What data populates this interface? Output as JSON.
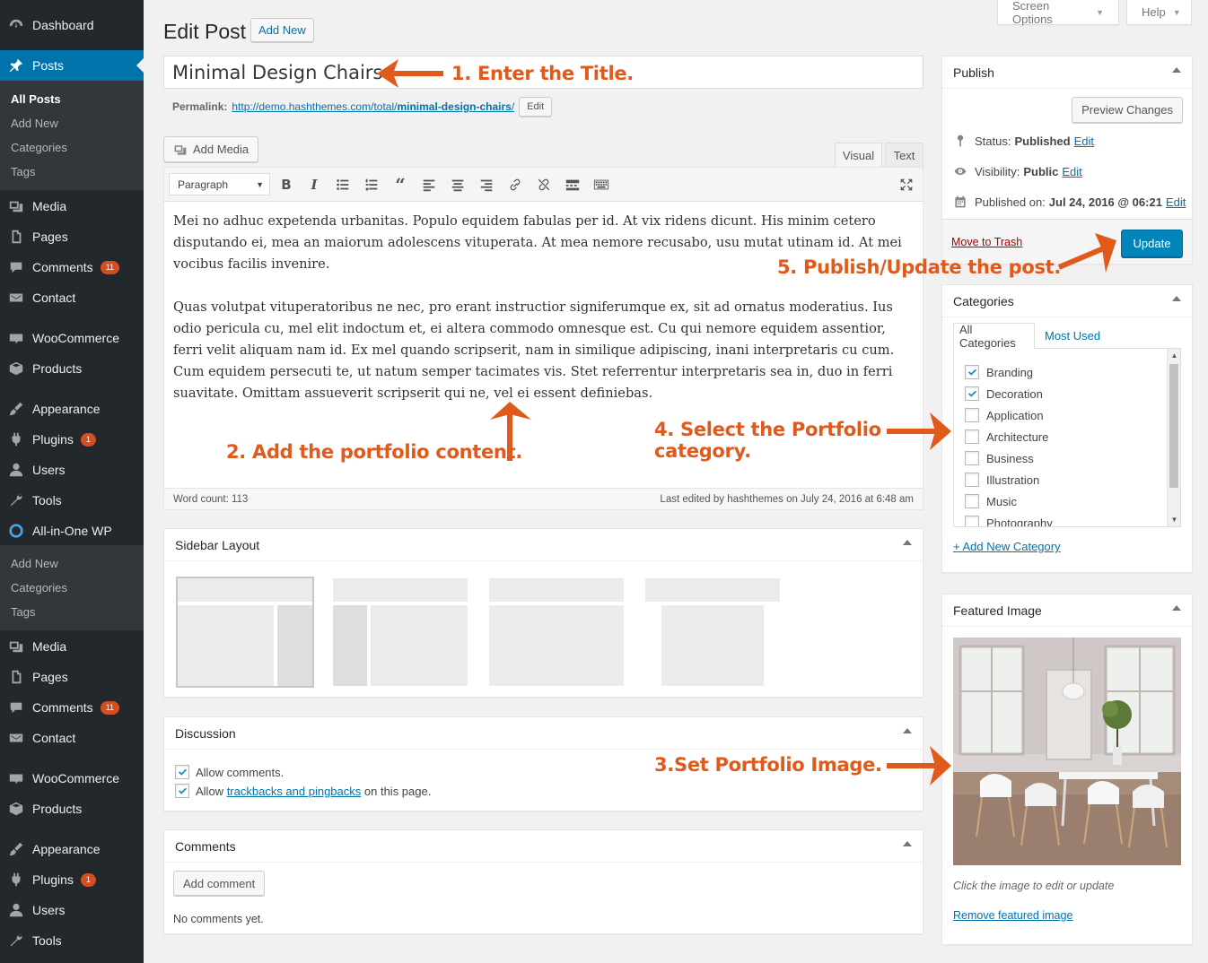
{
  "sidebar": {
    "top_items": [
      {
        "icon": "dashboard-icon",
        "label": "Dashboard"
      },
      {
        "icon": "pin-icon",
        "label": "Posts",
        "active": true
      }
    ],
    "posts_submenu": [
      "All Posts",
      "Add New",
      "Categories",
      "Tags"
    ],
    "items_a": [
      {
        "icon": "media-icon",
        "label": "Media"
      },
      {
        "icon": "pages-icon",
        "label": "Pages"
      },
      {
        "icon": "comments-icon",
        "label": "Comments",
        "badge": "11"
      },
      {
        "icon": "mail-icon",
        "label": "Contact"
      },
      {
        "icon": "woo-icon",
        "label": "WooCommerce"
      },
      {
        "icon": "box-icon",
        "label": "Products"
      },
      {
        "icon": "brush-icon",
        "label": "Appearance"
      },
      {
        "icon": "plug-icon",
        "label": "Plugins",
        "badge": "1"
      },
      {
        "icon": "user-icon",
        "label": "Users"
      },
      {
        "icon": "wrench-icon",
        "label": "Tools"
      },
      {
        "icon": "seo-icon",
        "label": "All-in-One WP"
      }
    ],
    "dup_submenu": [
      "Add New",
      "Categories",
      "Tags"
    ],
    "items_b": [
      {
        "icon": "media-icon",
        "label": "Media"
      },
      {
        "icon": "pages-icon",
        "label": "Pages"
      },
      {
        "icon": "comments-icon",
        "label": "Comments",
        "badge": "11"
      },
      {
        "icon": "mail-icon",
        "label": "Contact"
      },
      {
        "icon": "woo-icon",
        "label": "WooCommerce"
      },
      {
        "icon": "box-icon",
        "label": "Products"
      },
      {
        "icon": "brush-icon",
        "label": "Appearance"
      },
      {
        "icon": "plug-icon",
        "label": "Plugins",
        "badge": "1"
      },
      {
        "icon": "user-icon",
        "label": "Users"
      },
      {
        "icon": "wrench-icon",
        "label": "Tools"
      }
    ]
  },
  "header": {
    "title": "Edit Post",
    "add_new": "Add New",
    "screen_options": "Screen Options",
    "help": "Help"
  },
  "post": {
    "title": "Minimal Design Chairs",
    "permalink_label": "Permalink:",
    "permalink_base": "http://demo.hashthemes.com/total/",
    "permalink_slug": "minimal-design-chairs",
    "permalink_end": "/",
    "edit_slug": "Edit"
  },
  "editor": {
    "add_media": "Add Media",
    "tab_visual": "Visual",
    "tab_text": "Text",
    "format": "Paragraph",
    "bold": "B",
    "italic": "I",
    "paragraphs": [
      "Mei no adhuc expetenda urbanitas. Populo equidem fabulas per id. At vix ridens dicunt. His minim cetero disputando ei, mea an maiorum adolescens vituperata. At mea nemore recusabo, usu mutat utinam id. At mei vocibus facilis invenire.",
      "Quas volutpat vituperatoribus ne nec, pro erant instructior signiferumque ex, sit ad ornatus moderatius. Ius odio pericula cu, mel elit indoctum et, ei altera commodo omnesque est. Cu qui nemore equidem assentior, ferri velit aliquam nam id. Ex mel quando scripserit, nam in similique adipiscing, inani interpretaris cu cum. Cum equidem persecuti te, ut natum semper tacimates vis. Stet referrentur interpretaris sea in, duo in ferri suavitate. Omittam assueverit scripserit qui ne, vel ei essent definiebas."
    ],
    "word_count": "Word count: 113",
    "last_edited": "Last edited by hashthemes on July 24, 2016 at 6:48 am"
  },
  "sidebar_layout": {
    "title": "Sidebar Layout"
  },
  "discussion": {
    "title": "Discussion",
    "allow_comments": "Allow comments.",
    "allow_prefix": "Allow ",
    "trackbacks_link": "trackbacks and pingbacks",
    "allow_suffix": " on this page."
  },
  "comments": {
    "title": "Comments",
    "add_comment": "Add comment",
    "none": "No comments yet."
  },
  "publish": {
    "title": "Publish",
    "preview": "Preview Changes",
    "status_label": "Status:",
    "status_value": "Published",
    "visibility_label": "Visibility:",
    "visibility_value": "Public",
    "published_label": "Published on:",
    "published_value": "Jul 24, 2016 @ 06:21",
    "edit": "Edit",
    "trash": "Move to Trash",
    "update": "Update"
  },
  "categories": {
    "title": "Categories",
    "tab_all": "All Categories",
    "tab_used": "Most Used",
    "items": [
      {
        "label": "Branding",
        "checked": true
      },
      {
        "label": "Decoration",
        "checked": true
      },
      {
        "label": "Application",
        "checked": false
      },
      {
        "label": "Architecture",
        "checked": false
      },
      {
        "label": "Business",
        "checked": false
      },
      {
        "label": "Illustration",
        "checked": false
      },
      {
        "label": "Music",
        "checked": false
      },
      {
        "label": "Photography",
        "checked": false
      }
    ],
    "add_new": "+ Add New Category"
  },
  "featured": {
    "title": "Featured Image",
    "hint": "Click the image to edit or update",
    "remove": "Remove featured image"
  },
  "annotations": {
    "step1": "1. Enter the Title.",
    "step2": "2. Add the portfolio content.",
    "step3": "3.Set Portfolio Image.",
    "step4_line1": "4. Select the Portfolio",
    "step4_line2": "category.",
    "step5": "5. Publish/Update the post."
  },
  "colors": {
    "sidebar_bg": "#23282d",
    "active": "#0073aa",
    "annotation": "#e05a1c",
    "primary_btn": "#0085ba"
  }
}
